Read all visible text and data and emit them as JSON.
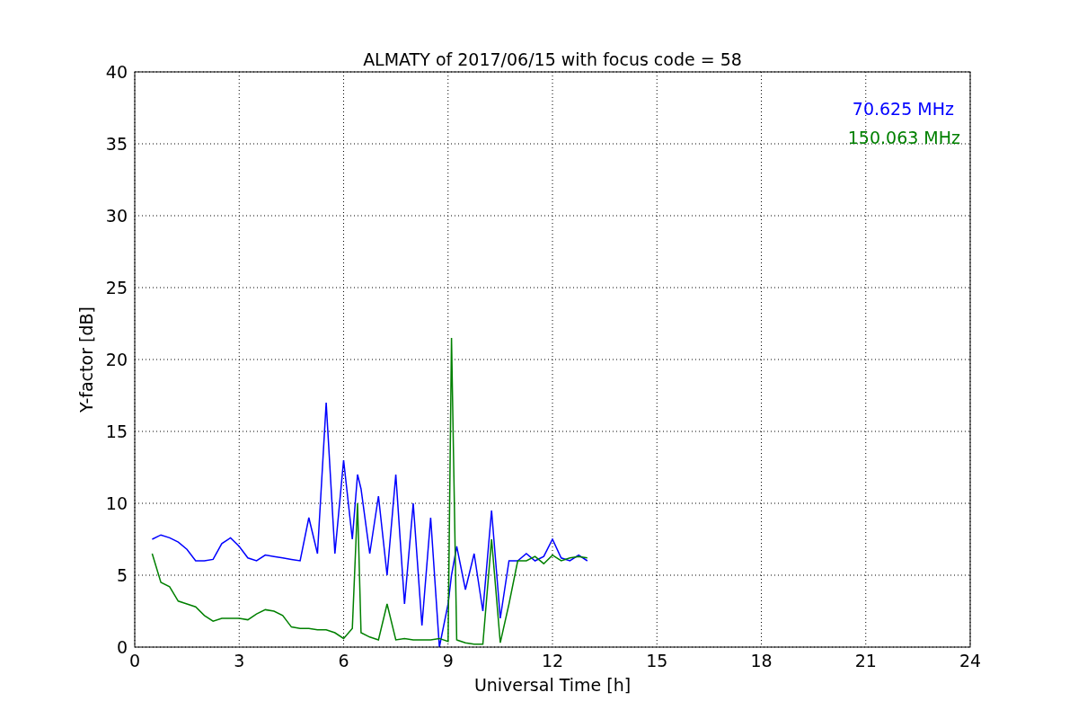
{
  "chart_data": {
    "type": "line",
    "title": "ALMATY of 2017/06/15 with focus code = 58",
    "xlabel": "Universal Time [h]",
    "ylabel": "Y-factor [dB]",
    "x": [
      0.5,
      0.75,
      1.0,
      1.25,
      1.5,
      1.75,
      2.0,
      2.25,
      2.5,
      2.75,
      3.0,
      3.25,
      3.5,
      3.75,
      4.0,
      4.25,
      4.5,
      4.75,
      5.0,
      5.25,
      5.5,
      5.75,
      6.0,
      6.25,
      6.4,
      6.5,
      6.75,
      7.0,
      7.25,
      7.5,
      7.75,
      8.0,
      8.25,
      8.5,
      8.75,
      9.0,
      9.1,
      9.25,
      9.5,
      9.75,
      10.0,
      10.25,
      10.5,
      10.75,
      11.0,
      11.25,
      11.5,
      11.75,
      12.0,
      12.25,
      12.5,
      12.75,
      13.0
    ],
    "series": [
      {
        "name": "70.625 MHz",
        "color": "#0000ff",
        "values": [
          7.5,
          7.8,
          7.6,
          7.3,
          6.8,
          6.0,
          6.0,
          6.1,
          7.2,
          7.6,
          7.0,
          6.2,
          6.0,
          6.4,
          6.3,
          6.2,
          6.1,
          6.0,
          9.0,
          6.5,
          17.0,
          6.5,
          13.0,
          7.5,
          12.0,
          11.0,
          6.5,
          10.5,
          5.0,
          12.0,
          3.0,
          10.0,
          1.5,
          9.0,
          0.0,
          3.0,
          5.0,
          7.0,
          4.0,
          6.5,
          2.5,
          9.5,
          2.0,
          6.0,
          6.0,
          6.5,
          6.0,
          6.3,
          7.5,
          6.2,
          6.0,
          6.4,
          6.0
        ]
      },
      {
        "name": "150.063 MHz",
        "color": "#008000",
        "values": [
          6.5,
          4.5,
          4.2,
          3.2,
          3.0,
          2.8,
          2.2,
          1.8,
          2.0,
          2.0,
          2.0,
          1.9,
          2.3,
          2.6,
          2.5,
          2.2,
          1.4,
          1.3,
          1.3,
          1.2,
          1.2,
          1.0,
          0.6,
          1.3,
          10.0,
          1.0,
          0.7,
          0.5,
          3.0,
          0.5,
          0.6,
          0.5,
          0.5,
          0.5,
          0.6,
          0.4,
          21.5,
          0.5,
          0.3,
          0.2,
          0.2,
          7.5,
          0.3,
          3.0,
          6.0,
          6.0,
          6.3,
          5.8,
          6.4,
          6.0,
          6.2,
          6.3,
          6.2
        ]
      }
    ],
    "grid": true,
    "xlim": [
      0,
      24
    ],
    "ylim": [
      0,
      40
    ],
    "xticks": [
      0,
      3,
      6,
      9,
      12,
      15,
      18,
      21,
      24
    ],
    "yticks": [
      0,
      5,
      10,
      15,
      20,
      25,
      30,
      35,
      40
    ]
  }
}
